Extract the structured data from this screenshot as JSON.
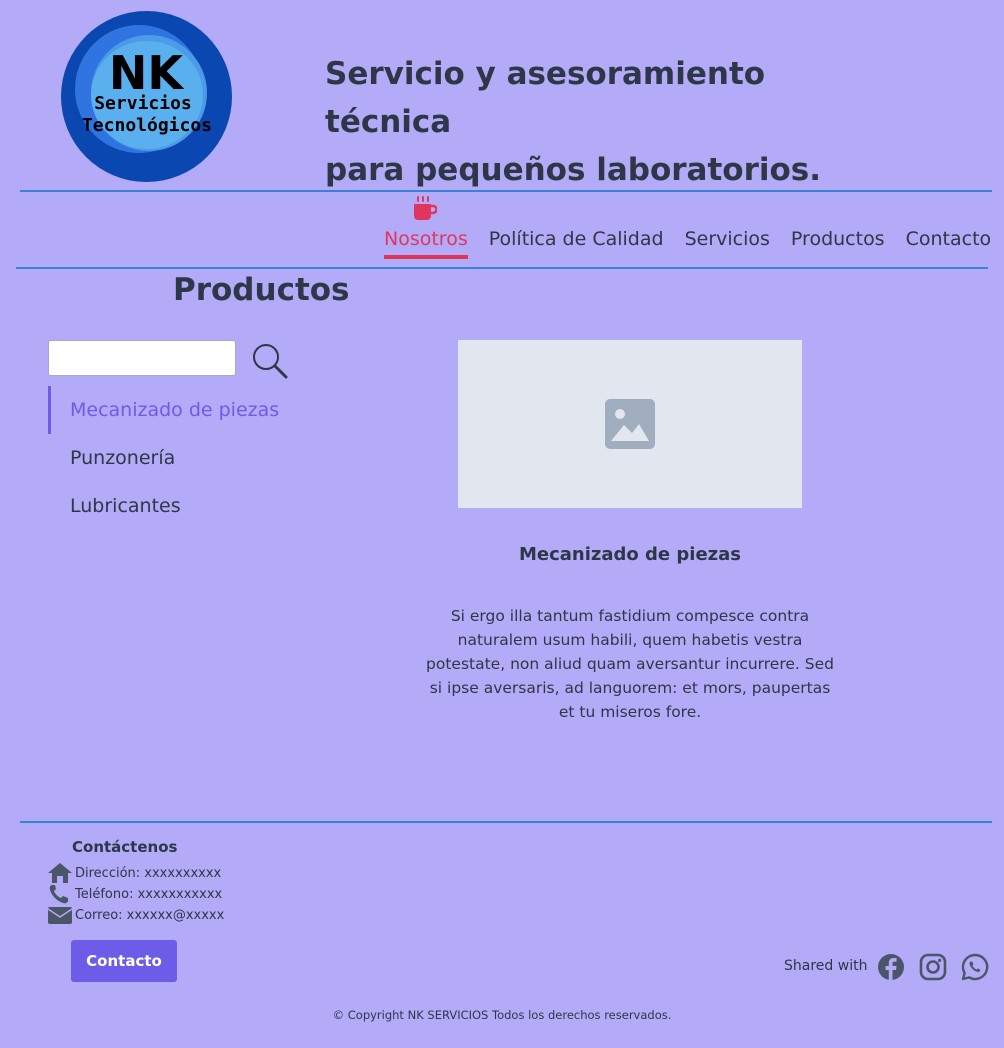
{
  "header": {
    "logo_text_main": "NK",
    "logo_text_sub1": "Servicios",
    "logo_text_sub2": "Tecnológicos",
    "tagline_line1": "Servicio y asesoramiento técnica",
    "tagline_line2": "para pequeños laboratorios."
  },
  "nav": {
    "icon": "coffee-cup-icon",
    "items": [
      {
        "label": "Nosotros",
        "active": true
      },
      {
        "label": "Política de Calidad",
        "active": false
      },
      {
        "label": "Servicios",
        "active": false
      },
      {
        "label": "Productos",
        "active": false
      },
      {
        "label": "Contacto",
        "active": false
      }
    ]
  },
  "main": {
    "page_title": "Productos",
    "search": {
      "value": "",
      "placeholder": ""
    },
    "product_list": [
      {
        "label": "Mecanizado de piezas",
        "active": true
      },
      {
        "label": "Punzonería",
        "active": false
      },
      {
        "label": "Lubricantes",
        "active": false
      }
    ],
    "product": {
      "title": "Mecanizado de piezas",
      "description": "Si ergo illa tantum fastidium compesce contra naturalem usum habili, quem habetis vestra potestate, non aliud quam aversantur incurrere. Sed si ipse aversaris, ad languorem: et mors, paupertas et tu miseros fore."
    }
  },
  "footer": {
    "title": "Contáctenos",
    "address": "Dirección: xxxxxxxxxx",
    "phone": "Teléfono: xxxxxxxxxxx",
    "email": "Correo: xxxxxx@xxxxx",
    "contact_button": "Contacto",
    "shared_label": "Shared with",
    "social": [
      "facebook-icon",
      "instagram-icon",
      "whatsapp-icon"
    ],
    "copyright": "© Copyright NK SERVICIOS Todos los derechos reservados."
  },
  "colors": {
    "background": "#b3aaf8",
    "accent": "#6c5ce7",
    "nav_active": "#e0365e",
    "divider": "#3b82d6",
    "text": "#2d3748"
  }
}
